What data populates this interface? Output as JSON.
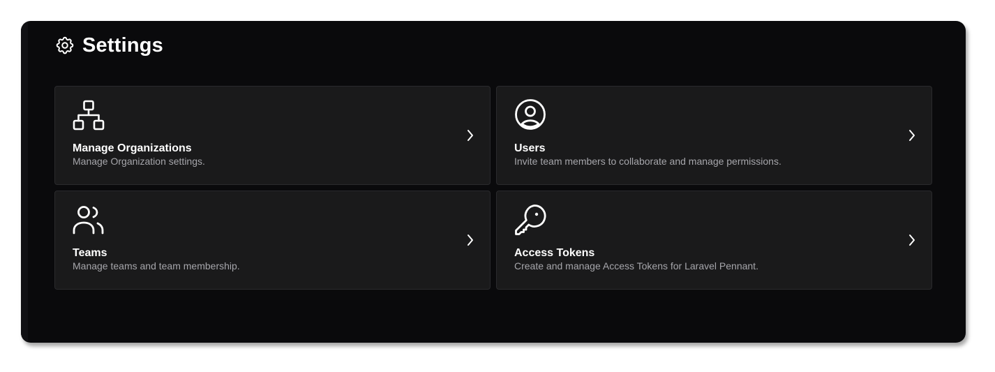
{
  "header": {
    "title": "Settings",
    "icon": "gear-icon"
  },
  "cards": [
    {
      "title": "Manage Organizations",
      "description": "Manage Organization settings.",
      "icon": "organization-icon"
    },
    {
      "title": "Users",
      "description": "Invite team members to collaborate and manage permissions.",
      "icon": "user-circle-icon"
    },
    {
      "title": "Teams",
      "description": "Manage teams and team membership.",
      "icon": "users-icon"
    },
    {
      "title": "Access Tokens",
      "description": "Create and manage Access Tokens for Laravel Pennant.",
      "icon": "key-icon"
    }
  ],
  "colors": {
    "window_bg": "#0a0a0c",
    "card_bg": "#1a1a1b",
    "card_border": "#2a2a2d",
    "text_primary": "#ffffff",
    "text_secondary": "#a6a6ab"
  }
}
